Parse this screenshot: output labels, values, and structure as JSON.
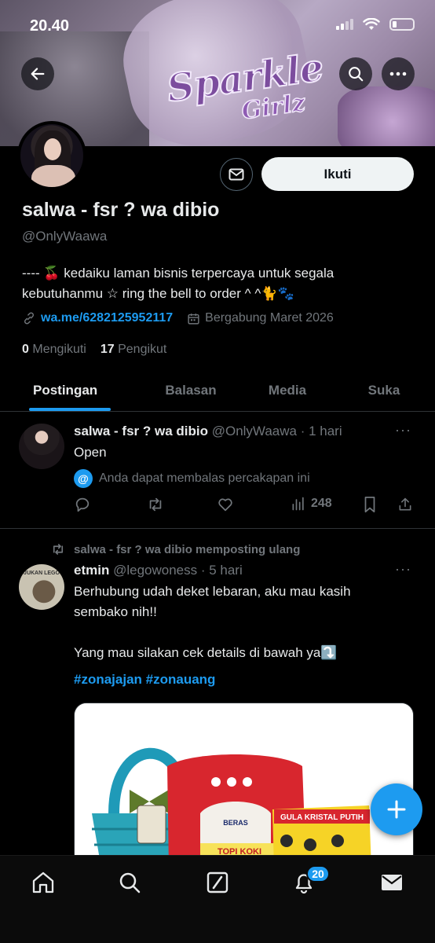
{
  "status_bar": {
    "time": "20.40"
  },
  "banner": {
    "art_text_line1": "Sparkle",
    "art_text_line2": "Girlz"
  },
  "profile": {
    "display_name": "salwa - fsr ? wa dibio",
    "handle": "@OnlyWaawa",
    "follow_label": "Ikuti",
    "bio_line1": "---- 🍒 kedaiku laman bisnis terpercaya untuk segala",
    "bio_line2": "kebutuhanmu ☆ ring the bell to order ^ ^🐈🐾",
    "link": "wa.me/6282125952117",
    "joined": "Bergabung Maret 2026",
    "following_count": "0",
    "following_label": "Mengikuti",
    "followers_count": "17",
    "followers_label": "Pengikut"
  },
  "tabs": [
    {
      "label": "Postingan"
    },
    {
      "label": "Balasan"
    },
    {
      "label": "Media"
    },
    {
      "label": "Suka"
    }
  ],
  "post1": {
    "name": "salwa - fsr ? wa dibio",
    "meta": "@OnlyWaawa · 1 hari",
    "text": "Open",
    "reply_note": "Anda dapat membalas percakapan ini",
    "views": "248"
  },
  "post2": {
    "repost_text": "salwa - fsr ? wa dibio memposting ulang",
    "name": "etmin",
    "meta": "@legowoness · 5 hari",
    "line1": "Berhubung udah deket lebaran, aku mau kasih",
    "line2": "sembako nih!!",
    "line3": "Yang mau silakan cek details di bawah ya⤵️",
    "hashtags": "#zonajajan #zonauang",
    "avatar_text": "JUKAN LEGO",
    "media_labels": {
      "sack1": "BERAS",
      "sack2": "TOPI KOKI",
      "sack3": "GULA KRISTAL PUTIH"
    }
  },
  "nav": {
    "notification_badge": "20"
  }
}
